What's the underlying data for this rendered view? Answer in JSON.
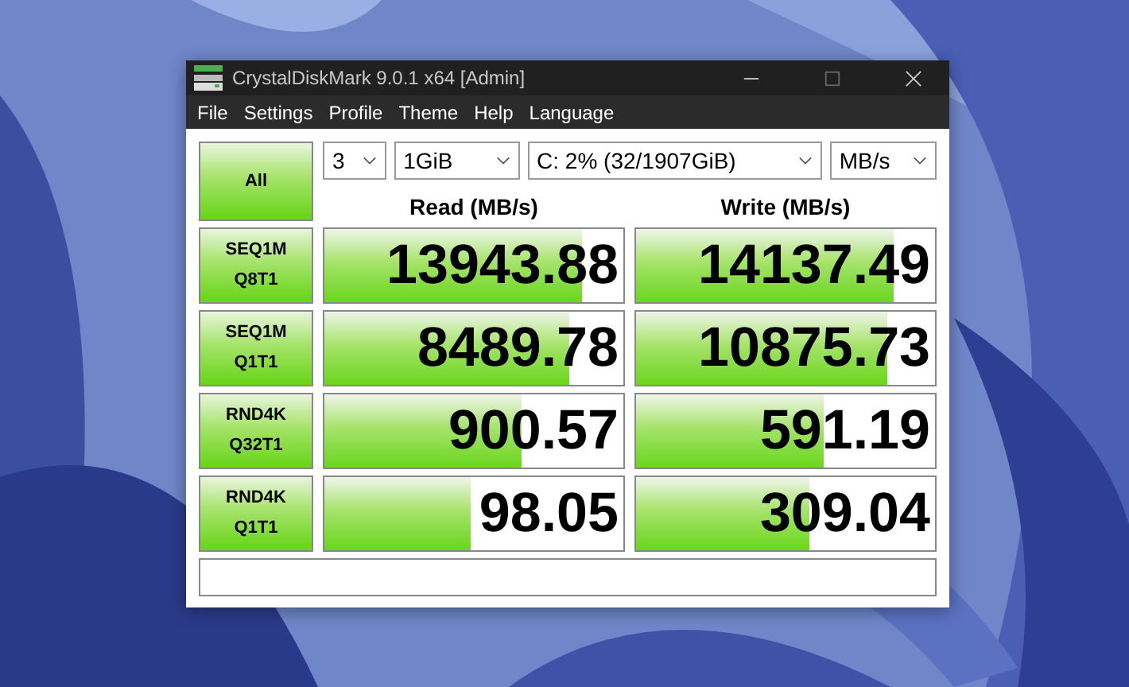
{
  "window": {
    "title": "CrystalDiskMark 9.0.1 x64 [Admin]"
  },
  "menu": [
    "File",
    "Settings",
    "Profile",
    "Theme",
    "Help",
    "Language"
  ],
  "all_button": "All",
  "dropdowns": [
    {
      "value": "3"
    },
    {
      "value": "1GiB"
    },
    {
      "value": "C: 2% (32/1907GiB)"
    },
    {
      "value": "MB/s"
    }
  ],
  "columns": [
    "Read (MB/s)",
    "Write (MB/s)"
  ],
  "tests": [
    {
      "label_lines": [
        "SEQ1M",
        "Q8T1"
      ],
      "read": {
        "value": "13943.88",
        "level": 0.86
      },
      "write": {
        "value": "14137.49",
        "level": 0.86
      }
    },
    {
      "label_lines": [
        "SEQ1M",
        "Q1T1"
      ],
      "read": {
        "value": "8489.78",
        "level": 0.82
      },
      "write": {
        "value": "10875.73",
        "level": 0.84
      }
    },
    {
      "label_lines": [
        "RND4K",
        "Q32T1"
      ],
      "read": {
        "value": "900.57",
        "level": 0.66
      },
      "write": {
        "value": "591.19",
        "level": 0.63
      }
    },
    {
      "label_lines": [
        "RND4K",
        "Q1T1"
      ],
      "read": {
        "value": "98.05",
        "level": 0.49
      },
      "write": {
        "value": "309.04",
        "level": 0.58
      }
    }
  ]
}
